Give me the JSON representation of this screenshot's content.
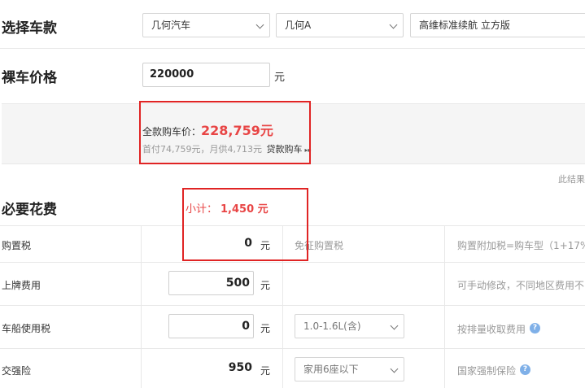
{
  "select_car": {
    "title": "选择车款",
    "brand": "几何汽车",
    "series": "几何A",
    "model": "高维标准续航 立方版"
  },
  "price": {
    "title": "裸车价格",
    "value": "220000",
    "unit": "元"
  },
  "summary": {
    "total_label": "全款购车价：",
    "total_value": "228,759元",
    "detail": "首付74,759元，月供4,713元",
    "loan_link": "贷款购车",
    "loan_arrow": "▸▸"
  },
  "note": "此结果",
  "required": {
    "title": "必要花费",
    "subtotal_label": "小计：",
    "subtotal_value": "1,450 元"
  },
  "rows": [
    {
      "name": "购置税",
      "value": "0",
      "unit": "元",
      "option": "免征购置税",
      "desc": "购置附加税=购车型（1+17%"
    },
    {
      "name": "上牌费用",
      "value": "500",
      "unit": "元",
      "option": "",
      "desc": "可手动修改，不同地区费用不同"
    },
    {
      "name": "车船使用税",
      "value": "0",
      "unit": "元",
      "option": "1.0-1.6L(含)",
      "desc": "按排量收取费用"
    },
    {
      "name": "交强险",
      "value": "950",
      "unit": "元",
      "option": "家用6座以下",
      "desc": "国家强制保险"
    }
  ],
  "colors": {
    "accent_red": "#e84545",
    "annotation": "#e02424",
    "help_icon": "#7fb0e8",
    "summary_bg": "#f5f5f5"
  }
}
